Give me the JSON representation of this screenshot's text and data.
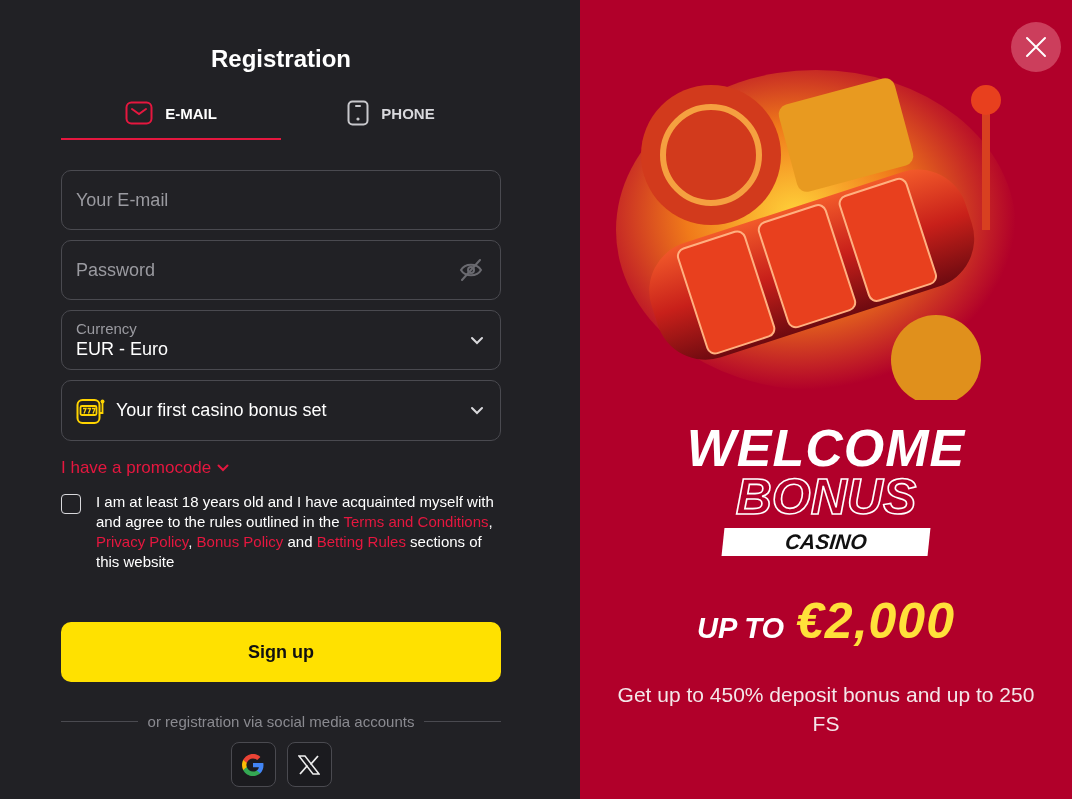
{
  "registration": {
    "title": "Registration",
    "tabs": [
      {
        "label": "E-MAIL",
        "selected": true
      },
      {
        "label": "PHONE",
        "selected": false
      }
    ],
    "email_field": {
      "placeholder": "Your E-mail"
    },
    "password_field": {
      "placeholder": "Password",
      "visible": false
    },
    "currency_select": {
      "label": "Currency",
      "value": "EUR - Euro"
    },
    "bonus_select": {
      "value": "Your first casino bonus set"
    },
    "promocode_link": {
      "label": "I have a promocode",
      "expanded": false
    },
    "agreement": {
      "checked": false,
      "segments": [
        {
          "kind": "text",
          "text": "I am at least 18 years old and I have acquainted myself with and agree to the rules outlined in the "
        },
        {
          "kind": "link",
          "text": "Terms and Conditions"
        },
        {
          "kind": "text",
          "text": ", "
        },
        {
          "kind": "link",
          "text": "Privacy Policy"
        },
        {
          "kind": "text",
          "text": ", "
        },
        {
          "kind": "link",
          "text": "Bonus Policy"
        },
        {
          "kind": "text",
          "text": " and "
        },
        {
          "kind": "link",
          "text": "Betting Rules"
        },
        {
          "kind": "text",
          "text": " sections of this website"
        }
      ]
    },
    "sign_up_button": "Sign up",
    "social_caption": "or registration via social media accounts"
  },
  "promo": {
    "headline": "WELCOME",
    "subheadline": "BONUS",
    "category": "CASINO",
    "amount_prefix": "UP TO",
    "amount": "€2,000",
    "description": "Get up to 450% deposit bonus and up to 250 FS"
  }
}
